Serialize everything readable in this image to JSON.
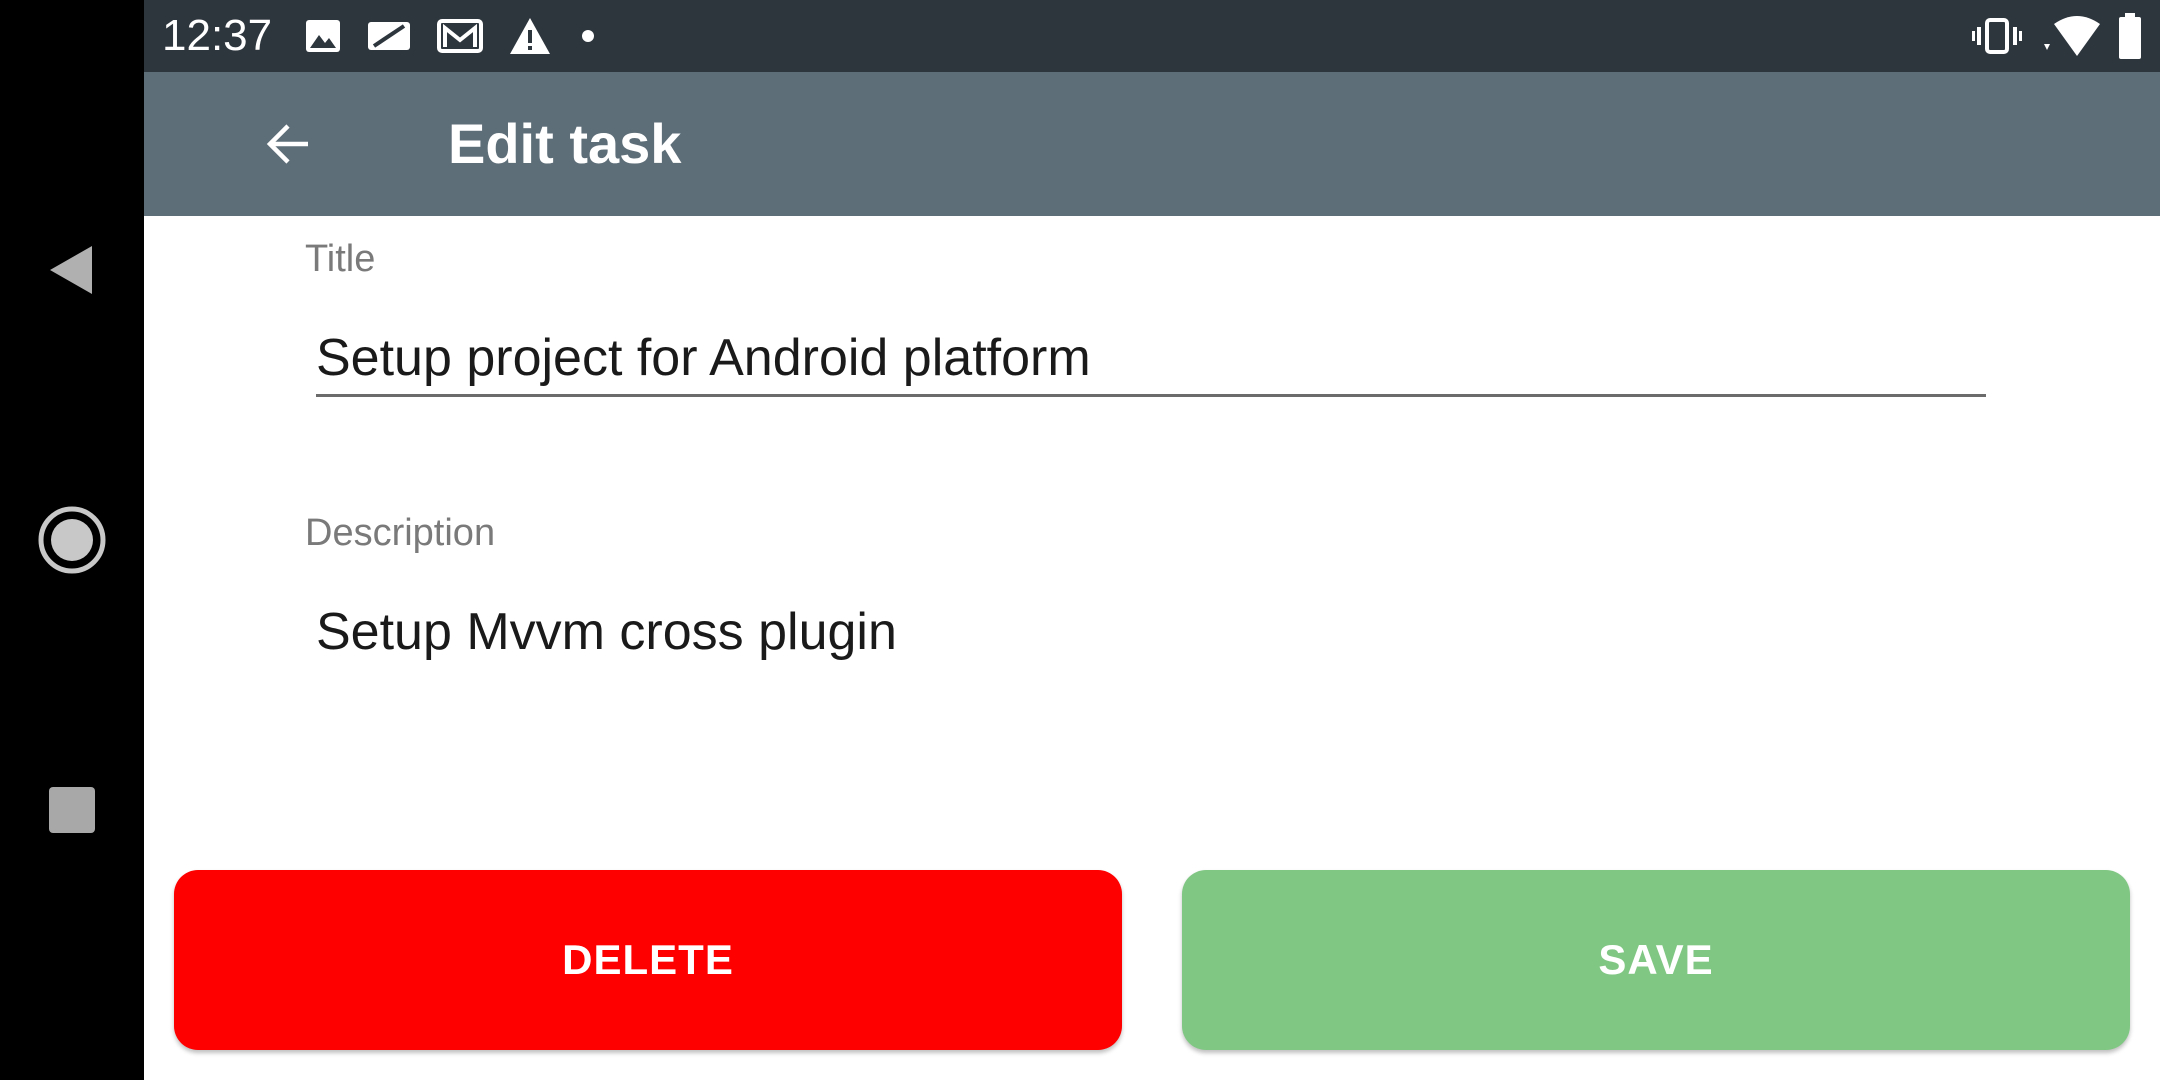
{
  "status_bar": {
    "time": "12:37",
    "left_icons": [
      "image-icon",
      "sim-icon",
      "gmail-icon",
      "warning-icon",
      "dot-icon"
    ],
    "right_icons": [
      "vibrate-icon",
      "wifi-icon",
      "battery-icon"
    ]
  },
  "app_bar": {
    "title": "Edit task",
    "back_icon": "arrow-back-icon"
  },
  "form": {
    "title_label": "Title",
    "title_value": "Setup project for Android platform",
    "description_label": "Description",
    "description_value": "Setup Mvvm cross plugin"
  },
  "actions": {
    "delete_label": "DELETE",
    "save_label": "SAVE"
  },
  "colors": {
    "status_bar": "#2d353d",
    "app_bar": "#5e6e78",
    "delete": "#ff0000",
    "save": "#81c784"
  }
}
